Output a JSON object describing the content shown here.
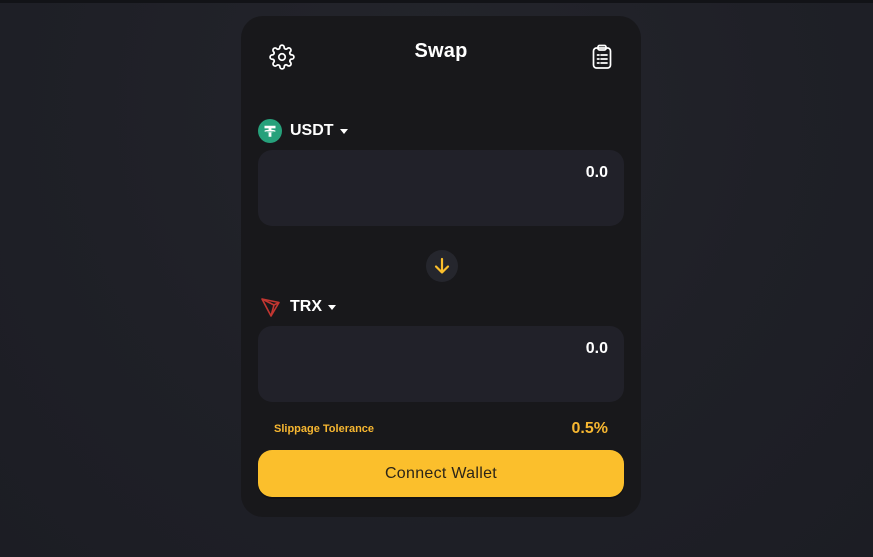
{
  "app": {
    "title": "Swap"
  },
  "header": {
    "settings_icon": "gear-icon",
    "history_icon": "clipboard-icon"
  },
  "from": {
    "token": "USDT",
    "token_icon": "tether-icon",
    "amount": "0.0"
  },
  "switch": {
    "icon": "arrow-down-icon"
  },
  "to": {
    "token": "TRX",
    "token_icon": "tron-icon",
    "amount": "0.0"
  },
  "slippage": {
    "label": "Slippage Tolerance",
    "value": "0.5%"
  },
  "action": {
    "label": "Connect Wallet"
  },
  "colors": {
    "accent": "#fbbf2c",
    "card": "#18181b",
    "field": "#212129",
    "tether": "#26a17b",
    "tron": "#c23631"
  }
}
